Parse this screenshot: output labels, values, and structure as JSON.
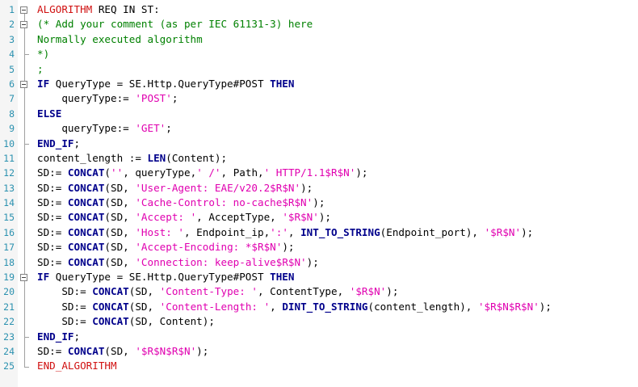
{
  "editor": {
    "lines": [
      {
        "n": "1",
        "tokens": [
          {
            "t": "ALGORITHM",
            "c": "kwr"
          },
          {
            "t": " REQ IN ST:",
            "c": ""
          }
        ]
      },
      {
        "n": "2",
        "tokens": [
          {
            "t": "(* Add your comment (as per IEC 61131-3) here",
            "c": "cmt"
          }
        ]
      },
      {
        "n": "3",
        "tokens": [
          {
            "t": "Normally executed algorithm",
            "c": "cmt"
          }
        ]
      },
      {
        "n": "4",
        "tokens": [
          {
            "t": "*)",
            "c": "cmt"
          }
        ]
      },
      {
        "n": "5",
        "tokens": [
          {
            "t": ";",
            "c": "cmt"
          }
        ]
      },
      {
        "n": "6",
        "tokens": [
          {
            "t": "IF",
            "c": "kw"
          },
          {
            "t": " QueryType = SE.Http.QueryType#POST ",
            "c": ""
          },
          {
            "t": "THEN",
            "c": "kw"
          }
        ]
      },
      {
        "n": "7",
        "tokens": [
          {
            "t": "    queryType:= ",
            "c": ""
          },
          {
            "t": "'POST'",
            "c": "str"
          },
          {
            "t": ";",
            "c": ""
          }
        ]
      },
      {
        "n": "8",
        "tokens": [
          {
            "t": "ELSE",
            "c": "kw"
          }
        ]
      },
      {
        "n": "9",
        "tokens": [
          {
            "t": "    queryType:= ",
            "c": ""
          },
          {
            "t": "'GET'",
            "c": "str"
          },
          {
            "t": ";",
            "c": ""
          }
        ]
      },
      {
        "n": "10",
        "tokens": [
          {
            "t": "END_IF",
            "c": "kw"
          },
          {
            "t": ";",
            "c": ""
          }
        ]
      },
      {
        "n": "11",
        "tokens": [
          {
            "t": "content_length := ",
            "c": ""
          },
          {
            "t": "LEN",
            "c": "kw"
          },
          {
            "t": "(Content);",
            "c": ""
          }
        ]
      },
      {
        "n": "12",
        "tokens": [
          {
            "t": "SD:= ",
            "c": ""
          },
          {
            "t": "CONCAT",
            "c": "kw"
          },
          {
            "t": "(",
            "c": ""
          },
          {
            "t": "''",
            "c": "str"
          },
          {
            "t": ", queryType,",
            "c": ""
          },
          {
            "t": "' /'",
            "c": "str"
          },
          {
            "t": ", Path,",
            "c": ""
          },
          {
            "t": "' HTTP/1.1$R$N'",
            "c": "str"
          },
          {
            "t": ");",
            "c": ""
          }
        ]
      },
      {
        "n": "13",
        "tokens": [
          {
            "t": "SD:= ",
            "c": ""
          },
          {
            "t": "CONCAT",
            "c": "kw"
          },
          {
            "t": "(SD, ",
            "c": ""
          },
          {
            "t": "'User-Agent: EAE/v20.2$R$N'",
            "c": "str"
          },
          {
            "t": ");",
            "c": ""
          }
        ]
      },
      {
        "n": "14",
        "tokens": [
          {
            "t": "SD:= ",
            "c": ""
          },
          {
            "t": "CONCAT",
            "c": "kw"
          },
          {
            "t": "(SD, ",
            "c": ""
          },
          {
            "t": "'Cache-Control: no-cache$R$N'",
            "c": "str"
          },
          {
            "t": ");",
            "c": ""
          }
        ]
      },
      {
        "n": "15",
        "tokens": [
          {
            "t": "SD:= ",
            "c": ""
          },
          {
            "t": "CONCAT",
            "c": "kw"
          },
          {
            "t": "(SD, ",
            "c": ""
          },
          {
            "t": "'Accept: '",
            "c": "str"
          },
          {
            "t": ", AcceptType, ",
            "c": ""
          },
          {
            "t": "'$R$N'",
            "c": "str"
          },
          {
            "t": ");",
            "c": ""
          }
        ]
      },
      {
        "n": "16",
        "tokens": [
          {
            "t": "SD:= ",
            "c": ""
          },
          {
            "t": "CONCAT",
            "c": "kw"
          },
          {
            "t": "(SD, ",
            "c": ""
          },
          {
            "t": "'Host: '",
            "c": "str"
          },
          {
            "t": ", Endpoint_ip,",
            "c": ""
          },
          {
            "t": "':'",
            "c": "str"
          },
          {
            "t": ", ",
            "c": ""
          },
          {
            "t": "INT_TO_STRING",
            "c": "kw"
          },
          {
            "t": "(Endpoint_port), ",
            "c": ""
          },
          {
            "t": "'$R$N'",
            "c": "str"
          },
          {
            "t": ");",
            "c": ""
          }
        ]
      },
      {
        "n": "17",
        "tokens": [
          {
            "t": "SD:= ",
            "c": ""
          },
          {
            "t": "CONCAT",
            "c": "kw"
          },
          {
            "t": "(SD, ",
            "c": ""
          },
          {
            "t": "'Accept-Encoding: *$R$N'",
            "c": "str"
          },
          {
            "t": ");",
            "c": ""
          }
        ]
      },
      {
        "n": "18",
        "tokens": [
          {
            "t": "SD:= ",
            "c": ""
          },
          {
            "t": "CONCAT",
            "c": "kw"
          },
          {
            "t": "(SD, ",
            "c": ""
          },
          {
            "t": "'Connection: keep-alive$R$N'",
            "c": "str"
          },
          {
            "t": ");",
            "c": ""
          }
        ]
      },
      {
        "n": "19",
        "tokens": [
          {
            "t": "IF",
            "c": "kw"
          },
          {
            "t": " QueryType = SE.Http.QueryType#POST ",
            "c": ""
          },
          {
            "t": "THEN",
            "c": "kw"
          }
        ]
      },
      {
        "n": "20",
        "tokens": [
          {
            "t": "    SD:= ",
            "c": ""
          },
          {
            "t": "CONCAT",
            "c": "kw"
          },
          {
            "t": "(SD, ",
            "c": ""
          },
          {
            "t": "'Content-Type: '",
            "c": "str"
          },
          {
            "t": ", ContentType, ",
            "c": ""
          },
          {
            "t": "'$R$N'",
            "c": "str"
          },
          {
            "t": ");",
            "c": ""
          }
        ]
      },
      {
        "n": "21",
        "tokens": [
          {
            "t": "    SD:= ",
            "c": ""
          },
          {
            "t": "CONCAT",
            "c": "kw"
          },
          {
            "t": "(SD, ",
            "c": ""
          },
          {
            "t": "'Content-Length: '",
            "c": "str"
          },
          {
            "t": ", ",
            "c": ""
          },
          {
            "t": "DINT_TO_STRING",
            "c": "kw"
          },
          {
            "t": "(content_length), ",
            "c": ""
          },
          {
            "t": "'$R$N$R$N'",
            "c": "str"
          },
          {
            "t": ");",
            "c": ""
          }
        ]
      },
      {
        "n": "22",
        "tokens": [
          {
            "t": "    SD:= ",
            "c": ""
          },
          {
            "t": "CONCAT",
            "c": "kw"
          },
          {
            "t": "(SD, Content);",
            "c": ""
          }
        ]
      },
      {
        "n": "23",
        "tokens": [
          {
            "t": "END_IF",
            "c": "kw"
          },
          {
            "t": ";",
            "c": ""
          }
        ]
      },
      {
        "n": "24",
        "tokens": [
          {
            "t": "SD:= ",
            "c": ""
          },
          {
            "t": "CONCAT",
            "c": "kw"
          },
          {
            "t": "(SD, ",
            "c": ""
          },
          {
            "t": "'$R$N$R$N'",
            "c": "str"
          },
          {
            "t": ");",
            "c": ""
          }
        ]
      },
      {
        "n": "25",
        "tokens": [
          {
            "t": "END_ALGORITHM",
            "c": "kwr"
          }
        ]
      }
    ],
    "folds": [
      {
        "start": 1,
        "end": 25
      },
      {
        "start": 2,
        "end": 4
      },
      {
        "start": 6,
        "end": 10
      },
      {
        "start": 19,
        "end": 23
      }
    ],
    "colors": {
      "keyword": "#00008b",
      "algorithm_keyword": "#d01010",
      "string": "#e000b0",
      "comment": "#008000",
      "line_number": "#2b91af"
    }
  }
}
